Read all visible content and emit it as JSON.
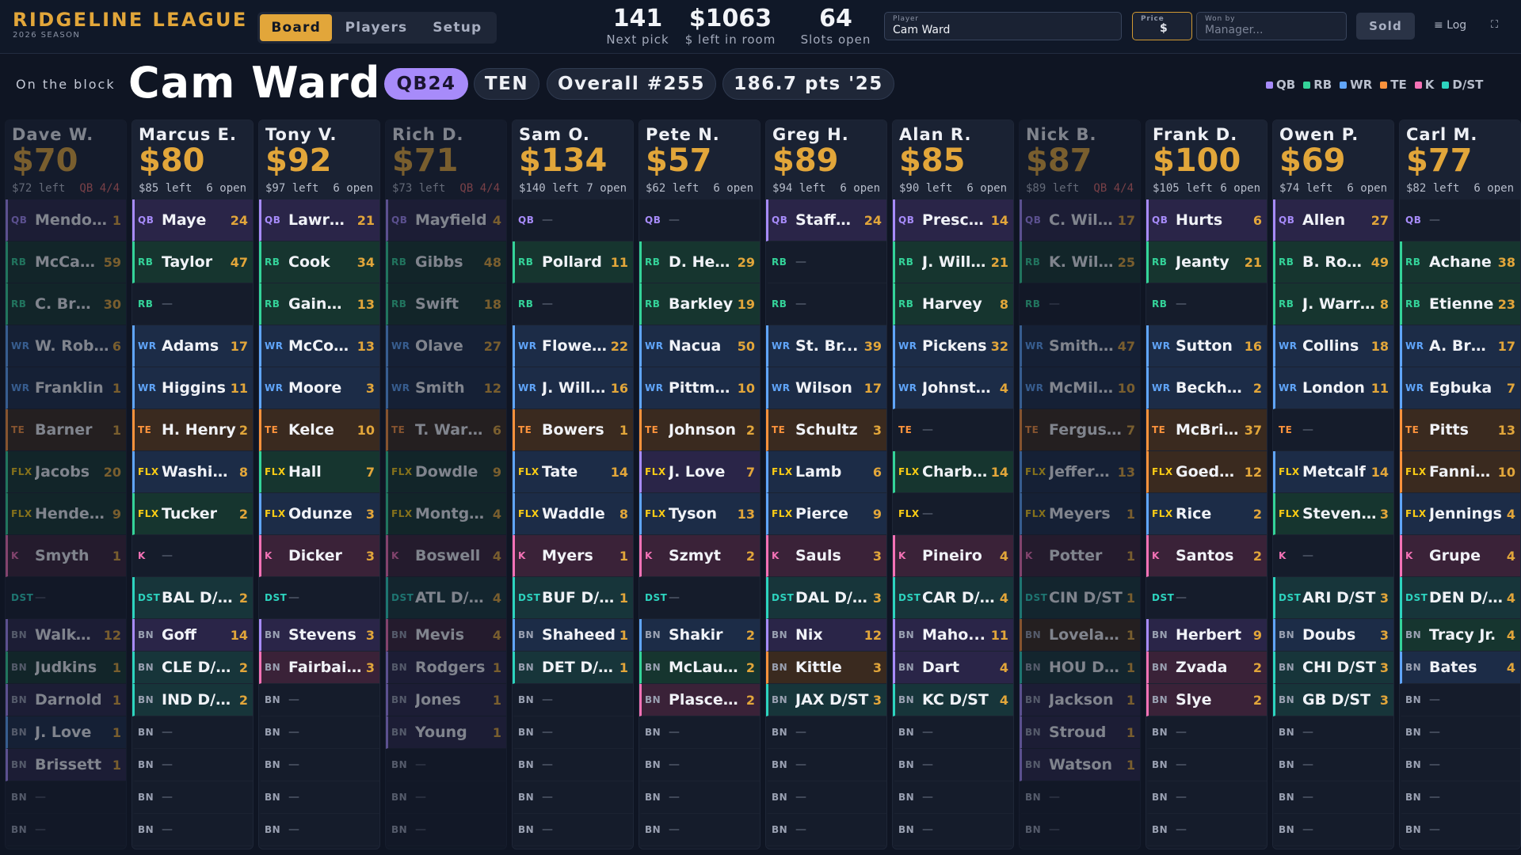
{
  "brand": {
    "title": "RIDGELINE LEAGUE",
    "season": "2026 SEASON"
  },
  "nav": {
    "tabs": [
      "Board",
      "Players",
      "Setup"
    ],
    "active": "Board"
  },
  "stats": [
    {
      "value": "141",
      "label": "Next pick"
    },
    {
      "value": "$1063",
      "label": "$ left in room"
    },
    {
      "value": "64",
      "label": "Slots open"
    }
  ],
  "form": {
    "player_label": "Player",
    "player_value": "Cam Ward",
    "price_label": "Price",
    "price_symbol": "$",
    "price_value": "",
    "won_by_label": "Won by",
    "won_by_placeholder": "Manager...",
    "sold_label": "Sold",
    "log_label": "≡ Log",
    "expand_icon": "⛶"
  },
  "block": {
    "label": "On the block",
    "player": "Cam Ward",
    "chips": [
      "QB24",
      "TEN",
      "Overall #255",
      "186.7 pts '25"
    ]
  },
  "legend": [
    {
      "label": "QB",
      "color": "#a78bfa"
    },
    {
      "label": "RB",
      "color": "#34d399"
    },
    {
      "label": "WR",
      "color": "#60a5fa"
    },
    {
      "label": "TE",
      "color": "#fb923c"
    },
    {
      "label": "K",
      "color": "#f472b6"
    },
    {
      "label": "D/ST",
      "color": "#2dd4bf"
    }
  ],
  "pos_colors": {
    "QB": {
      "fg": "#a78bfa",
      "bg": "#2a2548"
    },
    "RB": {
      "fg": "#34d399",
      "bg": "#16352f"
    },
    "WR": {
      "fg": "#60a5fa",
      "bg": "#1c2c47"
    },
    "TE": {
      "fg": "#fb923c",
      "bg": "#3a2a1f"
    },
    "FLX": {
      "fg": "#facc15",
      "bg": "#1c3a3a"
    },
    "K": {
      "fg": "#f472b6",
      "bg": "#3a2238"
    },
    "DST": {
      "fg": "#2dd4bf",
      "bg": "#17353a"
    },
    "BN": {
      "fg": "#9aa1b2",
      "bg": "#2a2838"
    }
  },
  "slot_labels": [
    "QB",
    "RB",
    "RB",
    "WR",
    "WR",
    "TE",
    "FLX",
    "FLX",
    "K",
    "DST",
    "BN",
    "BN",
    "BN",
    "BN",
    "BN",
    "BN",
    "BN"
  ],
  "empty_mark": "—",
  "teams": [
    {
      "manager": "Dave W.",
      "bid": "$70",
      "left": "$72 left",
      "open": "QB 4/4",
      "full": true,
      "players": [
        [
          "Mendoza",
          "1"
        ],
        [
          "McCaff...",
          "59"
        ],
        [
          "C. Bro...",
          "30"
        ],
        [
          "W. Robi...",
          "6"
        ],
        [
          "Franklin",
          "1"
        ],
        [
          "Barner",
          "1"
        ],
        [
          "Jacobs",
          "20"
        ],
        [
          "Hender...",
          "9"
        ],
        [
          "Smyth",
          "1"
        ],
        null,
        [
          "Walke...",
          "12"
        ],
        [
          "Judkins",
          "1"
        ],
        [
          "Darnold",
          "1"
        ],
        [
          "J. Love",
          "1"
        ],
        [
          "Brissett",
          "1"
        ],
        null,
        null
      ],
      "flex_pos": [
        "RB",
        "RB"
      ],
      "bench_pos": [
        "QB",
        "RB",
        "QB",
        "WR",
        "QB"
      ]
    },
    {
      "manager": "Marcus E.",
      "bid": "$80",
      "left": "$85 left",
      "open": "6 open",
      "full": false,
      "players": [
        [
          "Maye",
          "24"
        ],
        [
          "Taylor",
          "47"
        ],
        null,
        [
          "Adams",
          "17"
        ],
        [
          "Higgins",
          "11"
        ],
        [
          "H. Henry",
          "2"
        ],
        [
          "Washin...",
          "8"
        ],
        [
          "Tucker",
          "2"
        ],
        null,
        [
          "BAL D/ST",
          "2"
        ],
        [
          "Goff",
          "14"
        ],
        [
          "CLE D/ST",
          "2"
        ],
        [
          "IND D/ST",
          "2"
        ],
        null,
        null,
        null,
        null
      ],
      "flex_pos": [
        "WR",
        "RB"
      ],
      "bench_pos": [
        "QB",
        "DST",
        "DST"
      ]
    },
    {
      "manager": "Tony V.",
      "bid": "$92",
      "left": "$97 left",
      "open": "6 open",
      "full": false,
      "players": [
        [
          "Lawre...",
          "21"
        ],
        [
          "Cook",
          "34"
        ],
        [
          "Gainwell",
          "13"
        ],
        [
          "McCon...",
          "13"
        ],
        [
          "Moore",
          "3"
        ],
        [
          "Kelce",
          "10"
        ],
        [
          "Hall",
          "7"
        ],
        [
          "Odunze",
          "3"
        ],
        [
          "Dicker",
          "3"
        ],
        null,
        [
          "Stevens",
          "3"
        ],
        [
          "Fairbairn",
          "3"
        ],
        null,
        null,
        null,
        null,
        null
      ],
      "flex_pos": [
        "RB",
        "WR"
      ],
      "bench_pos": [
        "QB",
        "K"
      ]
    },
    {
      "manager": "Rich D.",
      "bid": "$71",
      "left": "$73 left",
      "open": "QB 4/4",
      "full": true,
      "players": [
        [
          "Mayfield",
          "4"
        ],
        [
          "Gibbs",
          "48"
        ],
        [
          "Swift",
          "18"
        ],
        [
          "Olave",
          "27"
        ],
        [
          "Smith",
          "12"
        ],
        [
          "T. Warren",
          "6"
        ],
        [
          "Dowdle",
          "9"
        ],
        [
          "Montgo...",
          "4"
        ],
        [
          "Boswell",
          "4"
        ],
        [
          "ATL D/ST",
          "4"
        ],
        [
          "Mevis",
          "4"
        ],
        [
          "Rodgers",
          "1"
        ],
        [
          "Jones",
          "1"
        ],
        [
          "Young",
          "1"
        ],
        null,
        null,
        null
      ],
      "flex_pos": [
        "RB",
        "RB"
      ],
      "bench_pos": [
        "K",
        "QB",
        "QB",
        "QB"
      ]
    },
    {
      "manager": "Sam O.",
      "bid": "$134",
      "left": "$140 left",
      "open": "7 open",
      "full": false,
      "players": [
        null,
        [
          "Pollard",
          "11"
        ],
        null,
        [
          "Flowers",
          "22"
        ],
        [
          "J. Willi...",
          "16"
        ],
        [
          "Bowers",
          "1"
        ],
        [
          "Tate",
          "14"
        ],
        [
          "Waddle",
          "8"
        ],
        [
          "Myers",
          "1"
        ],
        [
          "BUF D/ST",
          "1"
        ],
        [
          "Shaheed",
          "1"
        ],
        [
          "DET D/ST",
          "1"
        ],
        null,
        null,
        null,
        null,
        null
      ],
      "flex_pos": [
        "WR",
        "WR"
      ],
      "bench_pos": [
        "WR",
        "DST"
      ]
    },
    {
      "manager": "Pete N.",
      "bid": "$57",
      "left": "$62 left",
      "open": "6 open",
      "full": false,
      "players": [
        null,
        [
          "D. Hen...",
          "29"
        ],
        [
          "Barkley",
          "19"
        ],
        [
          "Nacua",
          "50"
        ],
        [
          "Pittman",
          "10"
        ],
        [
          "Johnson",
          "2"
        ],
        [
          "J. Love",
          "7"
        ],
        [
          "Tyson",
          "13"
        ],
        [
          "Szmyt",
          "2"
        ],
        null,
        [
          "Shakir",
          "2"
        ],
        [
          "McLaug...",
          "2"
        ],
        [
          "Plascen...",
          "2"
        ],
        null,
        null,
        null,
        null
      ],
      "flex_pos": [
        "QB",
        "WR"
      ],
      "bench_pos": [
        "WR",
        "RB",
        "K"
      ]
    },
    {
      "manager": "Greg H.",
      "bid": "$89",
      "left": "$94 left",
      "open": "6 open",
      "full": false,
      "players": [
        [
          "Stafford",
          "24"
        ],
        null,
        null,
        [
          "St. Br...",
          "39"
        ],
        [
          "Wilson",
          "17"
        ],
        [
          "Schultz",
          "3"
        ],
        [
          "Lamb",
          "6"
        ],
        [
          "Pierce",
          "9"
        ],
        [
          "Sauls",
          "3"
        ],
        [
          "DAL D/ST",
          "3"
        ],
        [
          "Nix",
          "12"
        ],
        [
          "Kittle",
          "3"
        ],
        [
          "JAX D/ST",
          "3"
        ],
        null,
        null,
        null,
        null
      ],
      "flex_pos": [
        "WR",
        "WR"
      ],
      "bench_pos": [
        "QB",
        "TE",
        "DST"
      ]
    },
    {
      "manager": "Alan R.",
      "bid": "$85",
      "left": "$90 left",
      "open": "6 open",
      "full": false,
      "players": [
        [
          "Prescott",
          "14"
        ],
        [
          "J. Willi...",
          "21"
        ],
        [
          "Harvey",
          "8"
        ],
        [
          "Pickens",
          "32"
        ],
        [
          "Johnston",
          "4"
        ],
        null,
        [
          "Charb...",
          "14"
        ],
        null,
        [
          "Pineiro",
          "4"
        ],
        [
          "CAR D/ST",
          "4"
        ],
        [
          "Maho...",
          "11"
        ],
        [
          "Dart",
          "4"
        ],
        [
          "KC D/ST",
          "4"
        ],
        null,
        null,
        null,
        null
      ],
      "flex_pos": [
        "RB",
        "RB"
      ],
      "bench_pos": [
        "QB",
        "QB",
        "DST"
      ]
    },
    {
      "manager": "Nick B.",
      "bid": "$87",
      "left": "$89 left",
      "open": "QB 4/4",
      "full": true,
      "players": [
        [
          "C. Will...",
          "17"
        ],
        [
          "K. Will...",
          "25"
        ],
        null,
        [
          "Smith-...",
          "47"
        ],
        [
          "McMill...",
          "10"
        ],
        [
          "Ferguson",
          "7"
        ],
        [
          "Jeffers...",
          "13"
        ],
        [
          "Meyers",
          "1"
        ],
        [
          "Potter",
          "1"
        ],
        [
          "CIN D/ST",
          "1"
        ],
        [
          "Loveland",
          "1"
        ],
        [
          "HOU D/...",
          "1"
        ],
        [
          "Jackson",
          "1"
        ],
        [
          "Stroud",
          "1"
        ],
        [
          "Watson",
          "1"
        ],
        null,
        null
      ],
      "flex_pos": [
        "WR",
        "WR"
      ],
      "bench_pos": [
        "TE",
        "DST",
        "QB",
        "QB",
        "QB"
      ]
    },
    {
      "manager": "Frank D.",
      "bid": "$100",
      "left": "$105 left",
      "open": "6 open",
      "full": false,
      "players": [
        [
          "Hurts",
          "6"
        ],
        [
          "Jeanty",
          "21"
        ],
        null,
        [
          "Sutton",
          "16"
        ],
        [
          "Beckha...",
          "2"
        ],
        [
          "McBride",
          "37"
        ],
        [
          "Goedert",
          "12"
        ],
        [
          "Rice",
          "2"
        ],
        [
          "Santos",
          "2"
        ],
        null,
        [
          "Herbert",
          "9"
        ],
        [
          "Zvada",
          "2"
        ],
        [
          "Slye",
          "2"
        ],
        null,
        null,
        null,
        null
      ],
      "flex_pos": [
        "TE",
        "WR"
      ],
      "bench_pos": [
        "QB",
        "K",
        "K"
      ]
    },
    {
      "manager": "Owen P.",
      "bid": "$69",
      "left": "$74 left",
      "open": "6 open",
      "full": false,
      "players": [
        [
          "Allen",
          "27"
        ],
        [
          "B. Rob...",
          "49"
        ],
        [
          "J. Warren",
          "8"
        ],
        [
          "Collins",
          "18"
        ],
        [
          "London",
          "11"
        ],
        null,
        [
          "Metcalf",
          "14"
        ],
        [
          "Steven...",
          "3"
        ],
        null,
        [
          "ARI D/ST",
          "3"
        ],
        [
          "Doubs",
          "3"
        ],
        [
          "CHI D/ST",
          "3"
        ],
        [
          "GB D/ST",
          "3"
        ],
        null,
        null,
        null,
        null
      ],
      "flex_pos": [
        "WR",
        "RB"
      ],
      "bench_pos": [
        "WR",
        "DST",
        "DST"
      ]
    },
    {
      "manager": "Carl M.",
      "bid": "$77",
      "left": "$82 left",
      "open": "6 open",
      "full": false,
      "players": [
        null,
        [
          "Achane",
          "38"
        ],
        [
          "Etienne",
          "23"
        ],
        [
          "A. Bro...",
          "17"
        ],
        [
          "Egbuka",
          "7"
        ],
        [
          "Pitts",
          "13"
        ],
        [
          "Fannin...",
          "10"
        ],
        [
          "Jennings",
          "4"
        ],
        [
          "Grupe",
          "4"
        ],
        [
          "DEN D/ST",
          "4"
        ],
        [
          "Tracy Jr.",
          "4"
        ],
        [
          "Bates",
          "4"
        ],
        null,
        null,
        null,
        null,
        null
      ],
      "flex_pos": [
        "TE",
        "WR"
      ],
      "bench_pos": [
        "RB",
        "WR"
      ]
    }
  ]
}
